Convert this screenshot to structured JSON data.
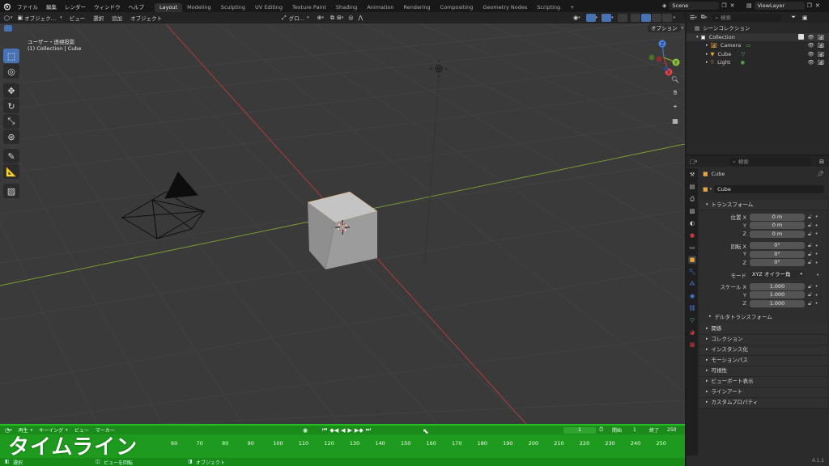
{
  "topbar": {
    "menus": [
      "ファイル",
      "編集",
      "レンダー",
      "ウィンドウ",
      "ヘルプ"
    ],
    "workspaces": [
      "Layout",
      "Modeling",
      "Sculpting",
      "UV Editing",
      "Texture Paint",
      "Shading",
      "Animation",
      "Rendering",
      "Compositing",
      "Geometry Nodes",
      "Scripting"
    ],
    "active_workspace": "Layout",
    "add_tab": "+",
    "scene": "Scene",
    "view_layer": "ViewLayer"
  },
  "viewport": {
    "mode": "オブジェク…",
    "menus": [
      "ビュー",
      "選択",
      "追加",
      "オブジェクト"
    ],
    "transform_orientation": "グロ…",
    "view_info": "ユーザー・透視投影",
    "object_info": "(1) Collection | Cube",
    "options": "オプション",
    "gizmo_axes": [
      "X",
      "Y",
      "Z"
    ]
  },
  "outliner": {
    "search_placeholder": "検索",
    "root": "シーンコレクション",
    "collection": "Collection",
    "items": [
      "Camera",
      "Cube",
      "Light"
    ]
  },
  "properties": {
    "search_placeholder": "検索",
    "object_name": "Cube",
    "datablock_name": "Cube",
    "transform_header": "トランスフォーム",
    "location_label": "位置 X",
    "rotation_label": "回転 X",
    "mode_label": "モード",
    "scale_label": "スケール X",
    "y": "Y",
    "z": "Z",
    "location": [
      "0 m",
      "0 m",
      "0 m"
    ],
    "rotation": [
      "0°",
      "0°",
      "0°"
    ],
    "rotation_mode": "XYZ オイラー角",
    "scale": [
      "1.000",
      "1.000",
      "1.000"
    ],
    "delta_transform": "デルタトランスフォーム",
    "panels": [
      "関係",
      "コレクション",
      "インスタンス化",
      "モーションパス",
      "可視性",
      "ビューポート表示",
      "ラインアート",
      "カスタムプロパティ"
    ],
    "version": "4.1.1"
  },
  "timeline": {
    "overlay_title": "タイムライン",
    "menus": [
      "再生",
      "キーイング",
      "ビュー",
      "マーカー"
    ],
    "current_frame": "1",
    "start_label": "開始",
    "start": "1",
    "end_label": "終了",
    "end": "250",
    "frame_ticks": [
      "60",
      "70",
      "80",
      "90",
      "100",
      "110",
      "120",
      "130",
      "140",
      "150",
      "160",
      "170",
      "180",
      "190",
      "200",
      "210",
      "220",
      "230",
      "240",
      "250"
    ]
  },
  "statusbar": {
    "items": [
      "選択",
      "ビューを回転",
      "オブジェクト"
    ]
  },
  "colors": {
    "accent": "#4772b3",
    "timeline_highlight": "#22c022",
    "x_axis": "#c0393b",
    "y_axis": "#7aa330",
    "z_axis": "#3b6fd1"
  }
}
